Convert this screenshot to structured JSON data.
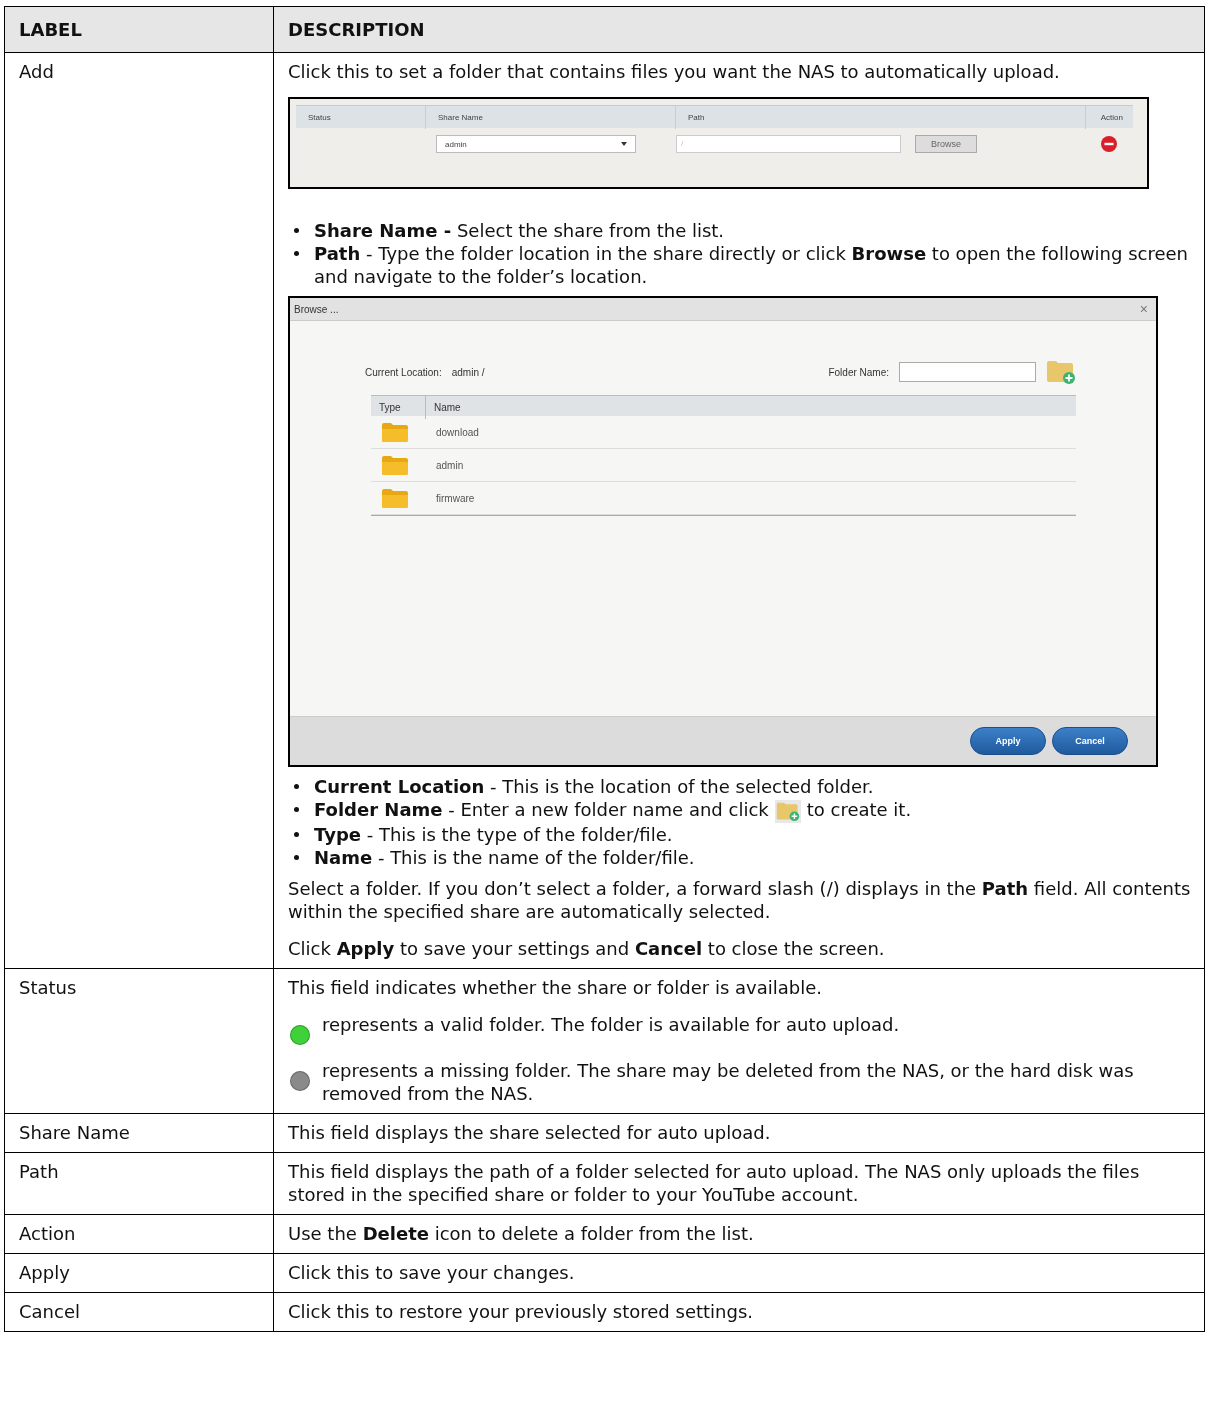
{
  "table": {
    "columns": [
      "LABEL",
      "DESCRIPTION"
    ],
    "rows": [
      {
        "label": "Add",
        "blocks": [
          {
            "kind": "para",
            "text": "Click this to set a folder that contains files you want the NAS to automatically upload."
          },
          {
            "kind": "share_screen",
            "columns": [
              "Status",
              "Share Name",
              "Path",
              "Action"
            ],
            "share": "admin",
            "path": "/",
            "browse": "Browse"
          },
          {
            "kind": "bullets",
            "items": [
              {
                "text": "**Share Name -** Select the share from the list."
              },
              {
                "text": "**Path** - Type the folder location in the share directly or click **Browse** to open the following screen and navigate to the folder’s location."
              }
            ]
          },
          {
            "kind": "browse_screen",
            "title": "Browse ...",
            "close": "×",
            "location_label": "Current Location:",
            "location": "admin /",
            "folder_label": "Folder Name:",
            "columns": [
              "Type",
              "Name"
            ],
            "folders": [
              "download",
              "admin",
              "firmware"
            ],
            "buttons": [
              "Apply",
              "Cancel"
            ]
          },
          {
            "kind": "bullets",
            "items": [
              {
                "text": "**Current Location** - This is the location of the selected folder."
              },
              {
                "text": "**Folder Name** - Enter a new folder name and click",
                "after": "to create it."
              },
              {
                "text": "**Type** - This is the type of the folder/file."
              },
              {
                "text": "**Name** - This is the name of the folder/file."
              }
            ]
          },
          {
            "kind": "para",
            "text": "Select a folder. If you don’t select a folder, a forward slash (/) displays in the **Path** field. All contents within the specified share are automatically selected."
          },
          {
            "kind": "para",
            "text": "Click **Apply** to save your settings and **Cancel** to close the screen."
          }
        ]
      },
      {
        "label": "Status",
        "blocks": [
          {
            "kind": "para",
            "text": "This field indicates whether the share or folder is available."
          },
          {
            "kind": "status_list",
            "items": [
              {
                "color": "#3fd13a",
                "text": "represents a valid folder. The folder is available for auto upload."
              },
              {
                "color": "#8a8a8a",
                "text": "represents a missing folder. The share may be deleted from the NAS, or the hard disk was removed from the NAS."
              }
            ]
          }
        ]
      },
      {
        "label": "Share Name",
        "blocks": [
          {
            "kind": "para",
            "text": "This field displays the share selected for auto upload."
          }
        ]
      },
      {
        "label": "Path",
        "blocks": [
          {
            "kind": "para",
            "text": "This field displays the path of a folder selected for auto upload. The NAS only uploads the files stored in the specified share or folder to your YouTube account."
          }
        ]
      },
      {
        "label": "Action",
        "blocks": [
          {
            "kind": "para",
            "text": "Use the **Delete** icon to delete a folder from the list."
          }
        ]
      },
      {
        "label": "Apply",
        "blocks": [
          {
            "kind": "para",
            "text": "Click this to save your changes."
          }
        ]
      },
      {
        "label": "Cancel",
        "blocks": [
          {
            "kind": "para",
            "text": "Click this to restore your previously stored settings."
          }
        ]
      }
    ]
  }
}
